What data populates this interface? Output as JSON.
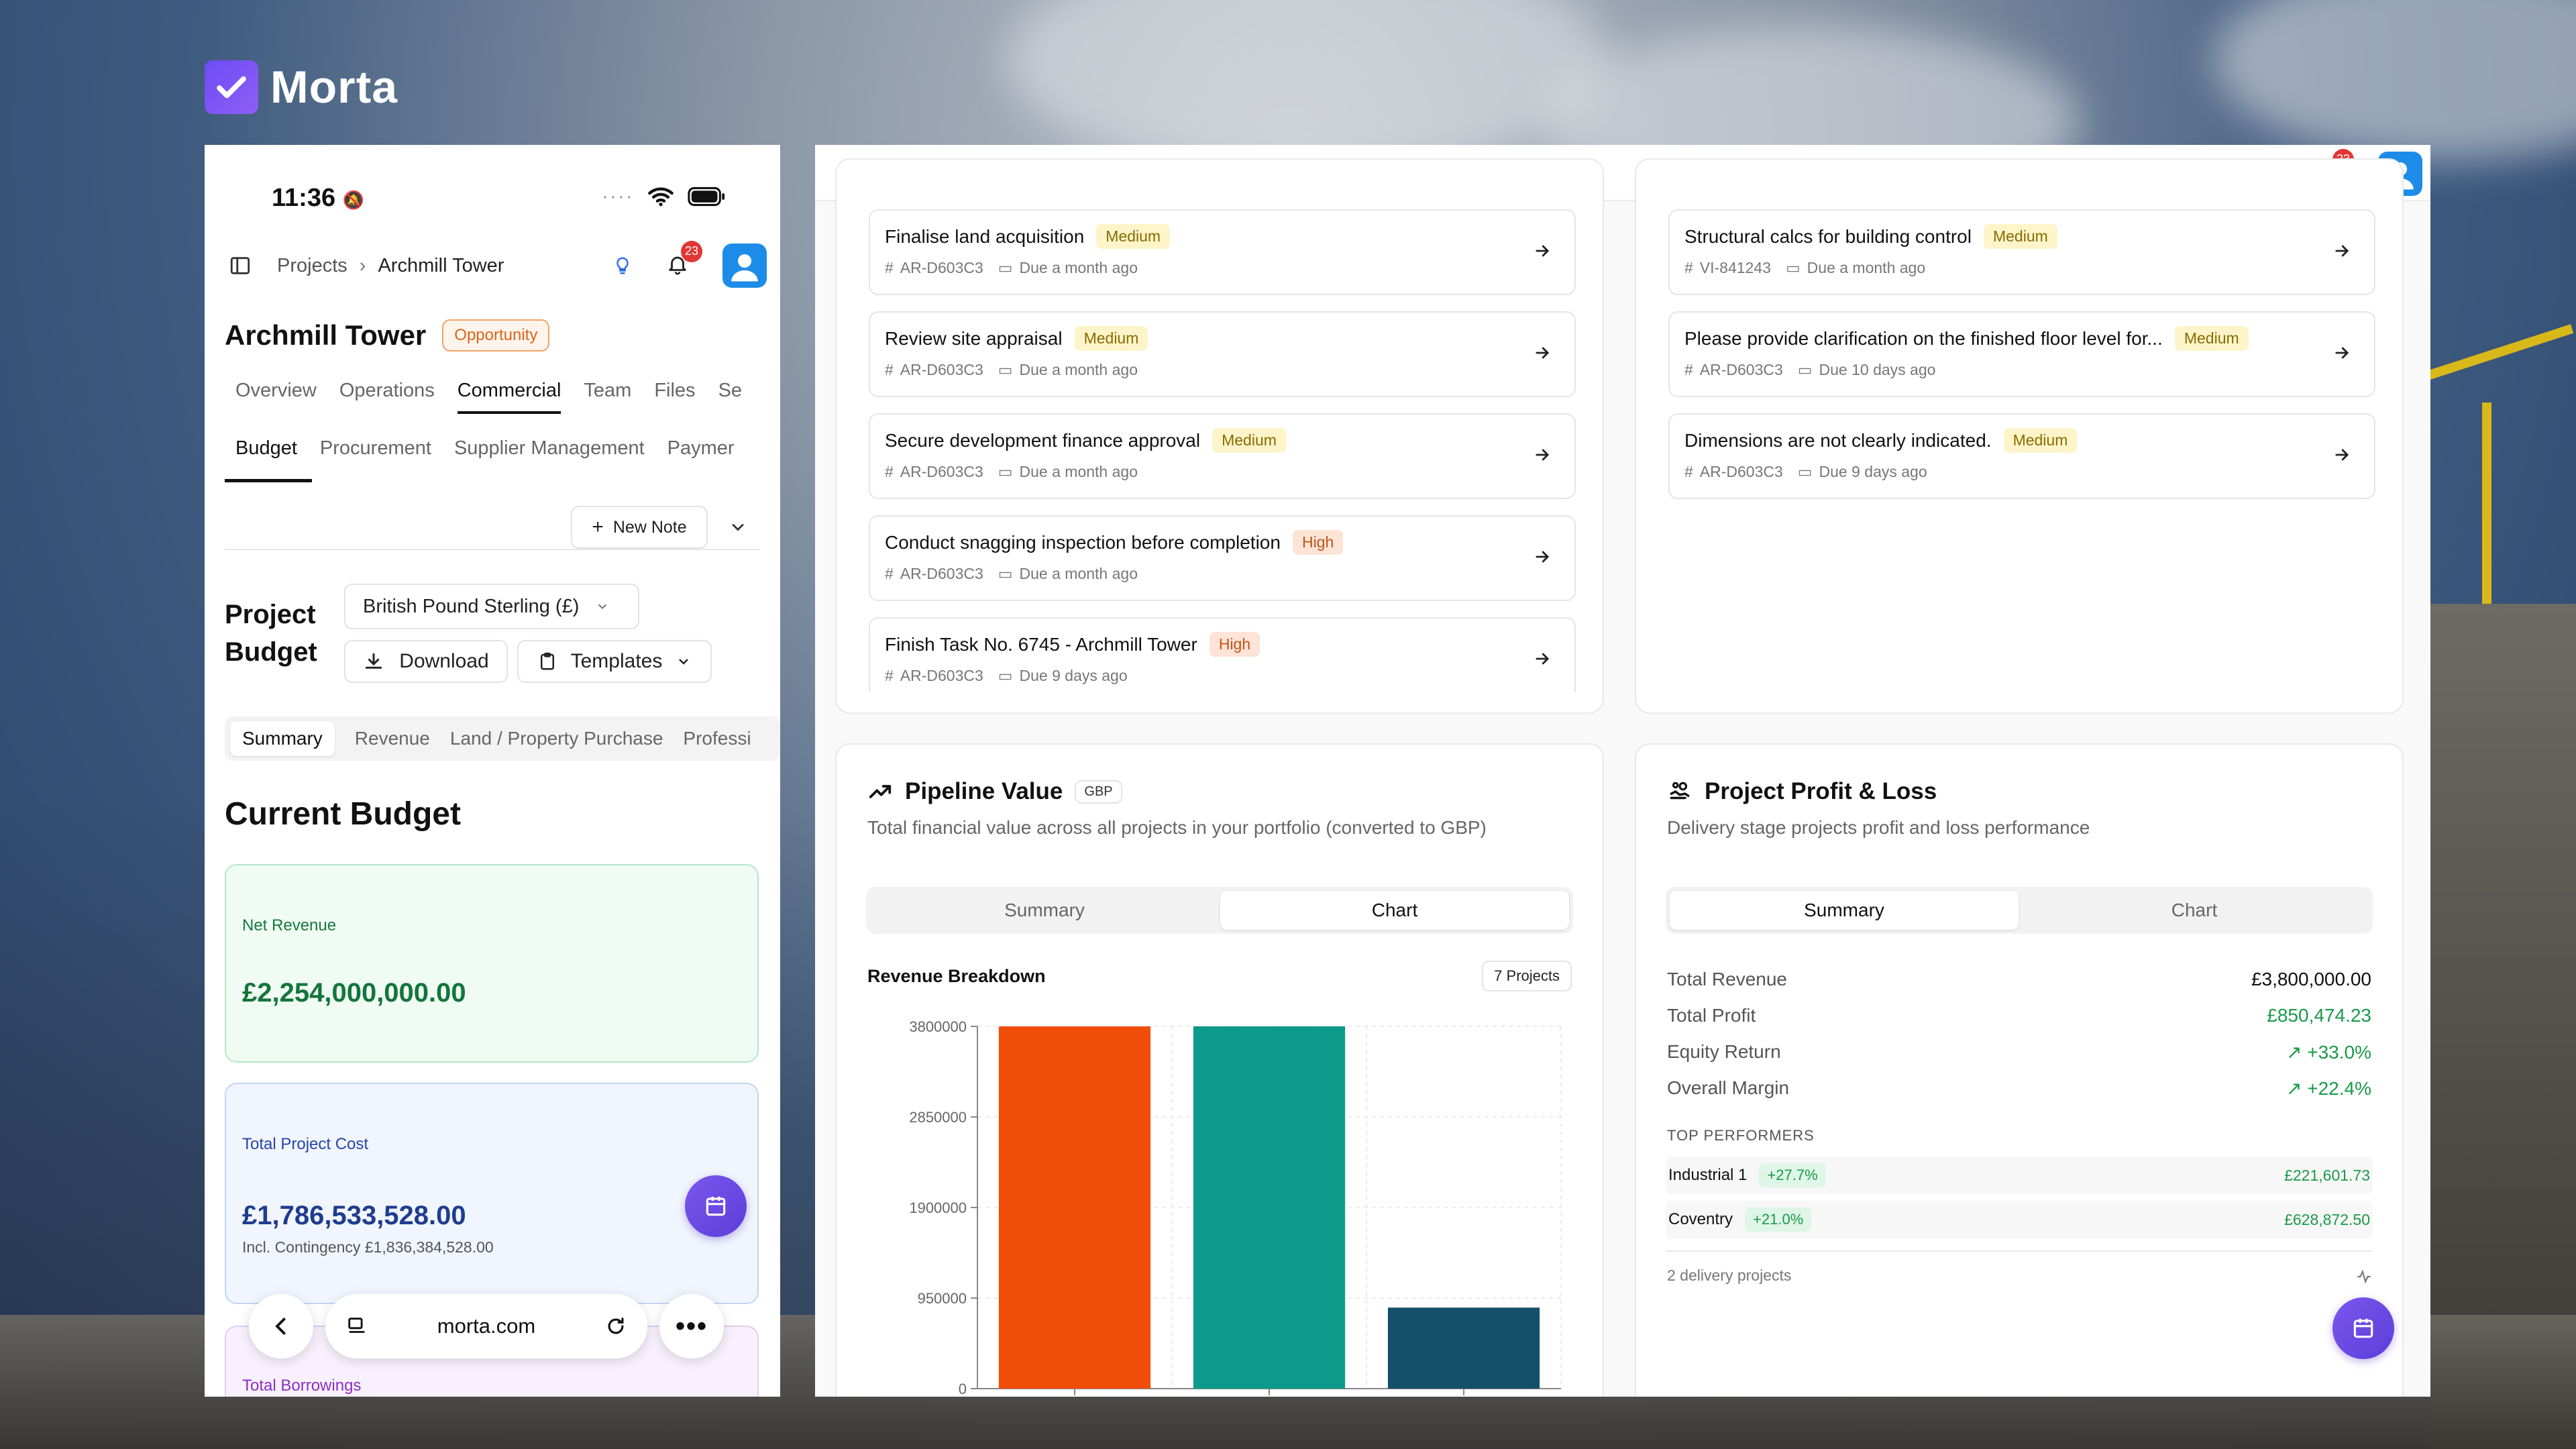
{
  "brand": {
    "name": "Morta"
  },
  "phone": {
    "time": "11:36",
    "breadcrumb": {
      "parent": "Projects",
      "current": "Archmill Tower"
    },
    "notifications_count": "23",
    "project": {
      "title": "Archmill Tower",
      "badge": "Opportunity"
    },
    "tabs": [
      "Overview",
      "Operations",
      "Commercial",
      "Team",
      "Files",
      "Se"
    ],
    "active_tab": "Commercial",
    "subtabs": [
      "Budget",
      "Procurement",
      "Supplier Management",
      "Paymer"
    ],
    "new_note": "New Note",
    "project_budget_title": "Project\nBudget",
    "currency": "British Pound Sterling (£)",
    "download": "Download",
    "templates": "Templates",
    "budget_tabs": [
      "Summary",
      "Revenue",
      "Land / Property Purchase",
      "Professi"
    ],
    "current_budget": "Current Budget",
    "net_revenue": {
      "label": "Net Revenue",
      "value": "£2,254,000,000.00"
    },
    "total_cost": {
      "label": "Total Project Cost",
      "value": "£1,786,533,528.00",
      "sub": "Incl. Contingency £1,836,384,528.00"
    },
    "total_borrowings": {
      "label": "Total Borrowings"
    },
    "browser": {
      "url": "morta.com"
    }
  },
  "desktop": {
    "notifications_count": "23",
    "tasks_left": [
      {
        "title": "Finalise land acquisition",
        "priority": "Medium",
        "ref": "AR-D603C3",
        "due": "Due a month ago"
      },
      {
        "title": "Review site appraisal",
        "priority": "Medium",
        "ref": "AR-D603C3",
        "due": "Due a month ago"
      },
      {
        "title": "Secure development finance approval",
        "priority": "Medium",
        "ref": "AR-D603C3",
        "due": "Due a month ago"
      },
      {
        "title": "Conduct snagging inspection before completion",
        "priority": "High",
        "ref": "AR-D603C3",
        "due": "Due a month ago"
      },
      {
        "title": "Finish Task No. 6745 - Archmill Tower",
        "priority": "High",
        "ref": "AR-D603C3",
        "due": "Due 9 days ago"
      }
    ],
    "tasks_right": [
      {
        "title": "Structural calcs for building control",
        "priority": "Medium",
        "ref": "VI-841243",
        "due": "Due a month ago"
      },
      {
        "title": "Please provide clarification on the finished floor level for...",
        "priority": "Medium",
        "ref": "AR-D603C3",
        "due": "Due 10 days ago"
      },
      {
        "title": "Dimensions are not clearly indicated.",
        "priority": "Medium",
        "ref": "AR-D603C3",
        "due": "Due 9 days ago"
      }
    ],
    "pipeline": {
      "title": "Pipeline Value",
      "currency_badge": "GBP",
      "desc": "Total financial value across all projects in your portfolio (converted to GBP)",
      "seg": [
        "Summary",
        "Chart"
      ],
      "active_seg": "Chart",
      "breakdown_title": "Revenue Breakdown",
      "projects_badge": "7 Projects"
    },
    "profit_loss": {
      "title": "Project Profit & Loss",
      "desc": "Delivery stage projects profit and loss performance",
      "seg": [
        "Summary",
        "Chart"
      ],
      "active_seg": "Summary",
      "rows": [
        {
          "label": "Total Revenue",
          "value": "£3,800,000.00"
        },
        {
          "label": "Total Profit",
          "value": "£850,474.23"
        },
        {
          "label": "Equity Return",
          "value": "+33.0%"
        },
        {
          "label": "Overall Margin",
          "value": "+22.4%"
        }
      ],
      "top_performers_label": "TOP PERFORMERS",
      "performers": [
        {
          "name": "Industrial 1",
          "change": "+27.7%",
          "amount": "£221,601.73"
        },
        {
          "name": "Coventry",
          "change": "+21.0%",
          "amount": "£628,872.50"
        }
      ],
      "footer": "2 delivery projects"
    }
  },
  "chart_data": {
    "type": "bar",
    "title": "Revenue Breakdown",
    "categories": [
      "",
      "",
      ""
    ],
    "values": [
      3800000,
      3800000,
      850000
    ],
    "colors": [
      "#f14d0a",
      "#0c9a8a",
      "#14506a"
    ],
    "yticks": [
      0,
      950000,
      1900000,
      2850000,
      3800000
    ],
    "ylim": [
      0,
      3800000
    ],
    "grid": true
  },
  "colors": {
    "accent": "#6d4cf5",
    "medium": "#fdf5c9",
    "high": "#fde4d6",
    "positive": "#1a9a49"
  }
}
